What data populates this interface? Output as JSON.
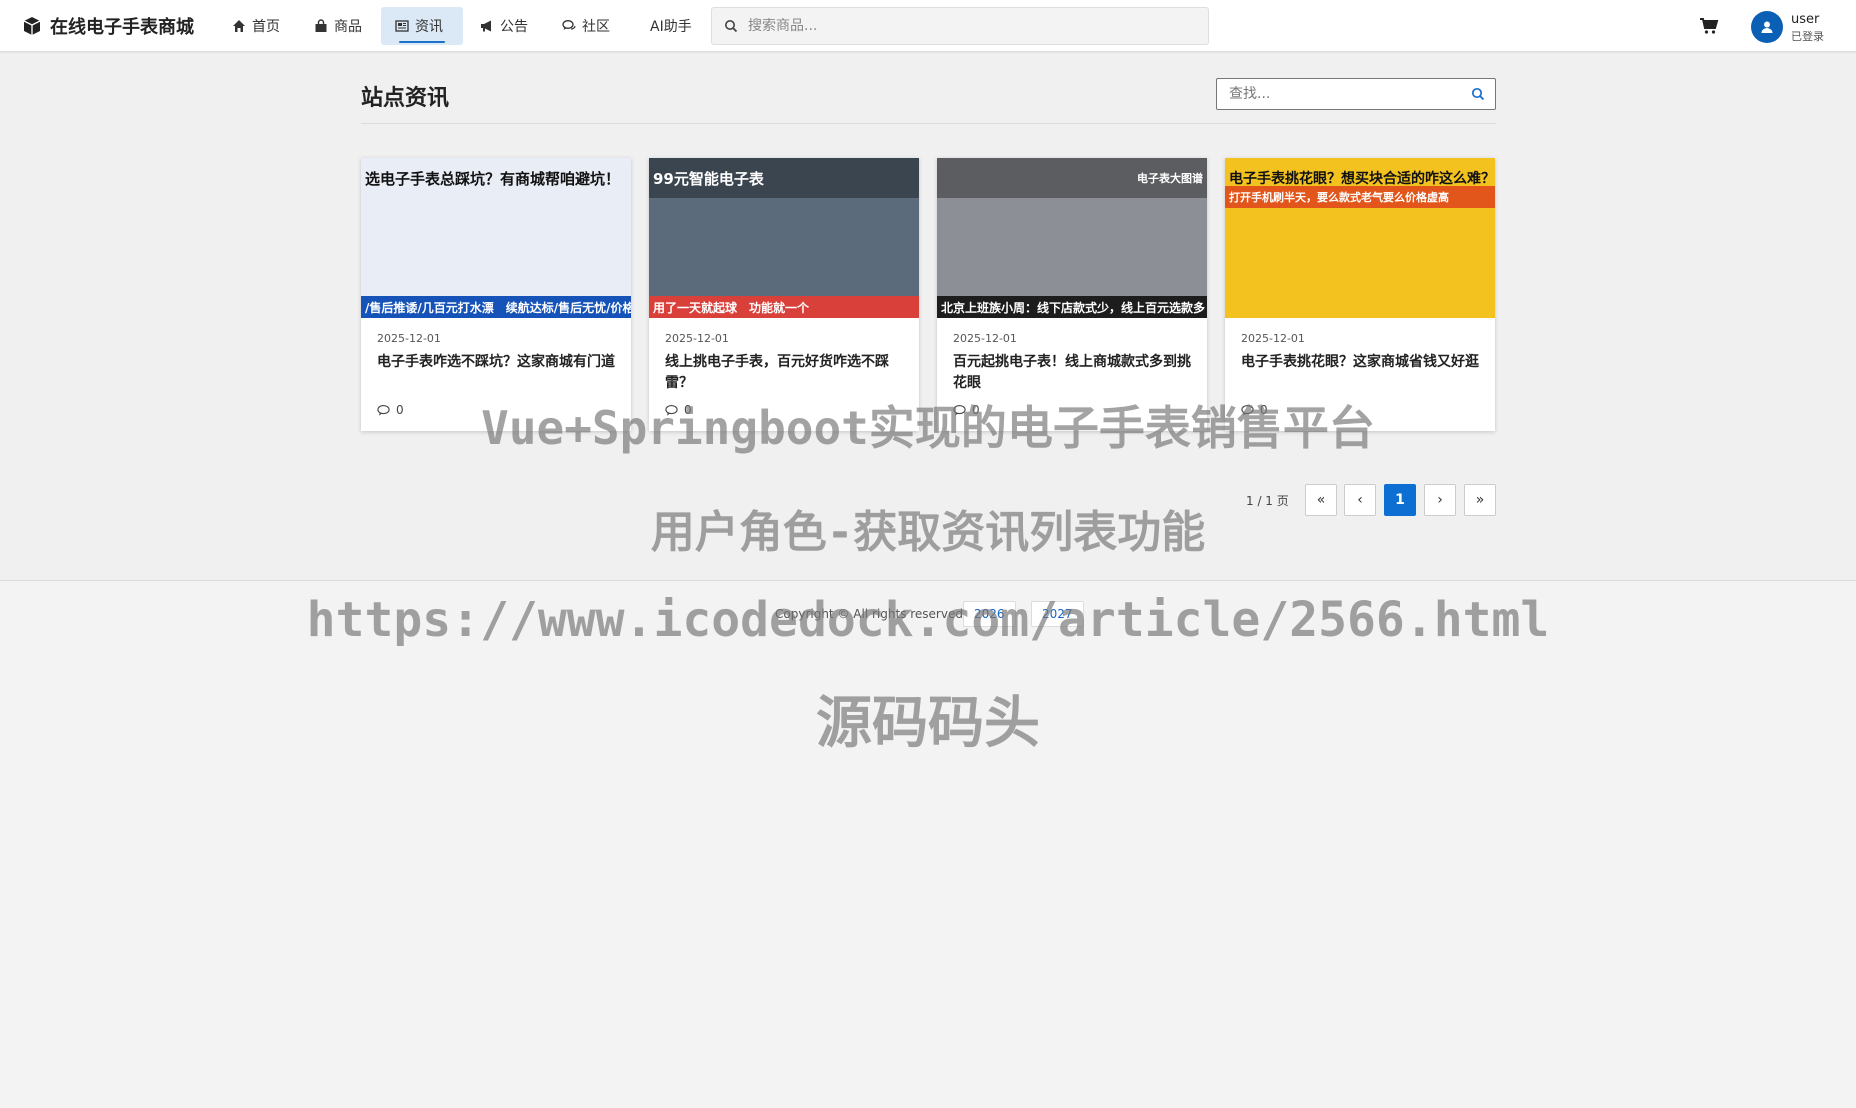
{
  "app": {
    "brand": "在线电子手表商城"
  },
  "nav": {
    "items": [
      {
        "label": "首页"
      },
      {
        "label": "商品"
      },
      {
        "label": "资讯"
      },
      {
        "label": "公告"
      },
      {
        "label": "社区"
      },
      {
        "label": "AI助手"
      }
    ],
    "active": "资讯",
    "search_placeholder": "搜索商品...",
    "user_name": "user",
    "user_status": "已登录"
  },
  "content": {
    "title": "站点资讯",
    "find_placeholder": "查找...",
    "cards": [
      {
        "date": "2025-12-01",
        "title": "电子手表咋选不踩坑？这家商城有门道",
        "comments": "0",
        "image_headline": "选电子手表总踩坑？有商城帮咱避坑！",
        "image_caption": "/售后推诿/几百元打水漂　续航达标/售后无忧/价格透明",
        "image_bg": "#e9eef6",
        "image_accent": "#1553b8"
      },
      {
        "date": "2025-12-01",
        "title": "线上挑电子手表，百元好货咋选不踩雷？",
        "comments": "0",
        "image_headline": "99元智能电子表",
        "image_caption": "用了一天就起球　功能就一个",
        "image_bg": "#5b6b7c",
        "image_accent": "#d9403a"
      },
      {
        "date": "2025-12-01",
        "title": "百元起挑电子表！线上商城款式多到挑花眼",
        "comments": "0",
        "image_headline": "电子表大图谱",
        "image_caption": "北京上班族小周：线下店款式少，线上百元选款多",
        "image_bg": "#8c8f96",
        "image_accent": "#1d1d1d"
      },
      {
        "date": "2025-12-01",
        "title": "电子手表挑花眼？这家商城省钱又好逛",
        "comments": "0",
        "image_headline": "电子手表挑花眼？想买块合适的咋这么难？",
        "image_caption": "打开手机刷半天，要么款式老气要么价格虚高",
        "image_bg": "#f4c21f",
        "image_accent": "#e2561b"
      }
    ]
  },
  "pagination": {
    "info": "1 / 1 页",
    "first": "«",
    "prev": "‹",
    "current": "1",
    "next": "›",
    "last": "»"
  },
  "footer": {
    "copyright": "Copyright © All rights reserved.",
    "years": [
      "2026",
      "2027"
    ]
  },
  "watermark": {
    "line1": "Vue+Springboot实现的电子手表销售平台",
    "line2": "用户角色-获取资讯列表功能",
    "line3": "https://www.icodedock.com/article/2566.html",
    "line4": "源码码头"
  },
  "colors": {
    "primary": "#0d6fd1",
    "nav_active_bg": "#dbe8f5",
    "page_bg": "#f0f0f0"
  }
}
